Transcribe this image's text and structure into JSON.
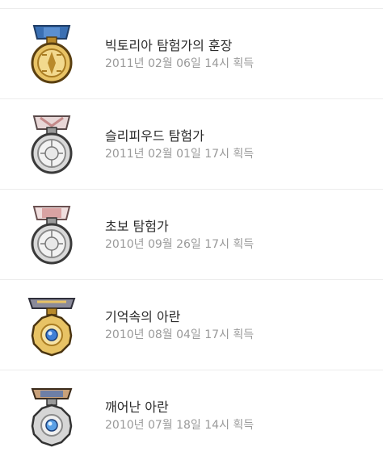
{
  "medals": [
    {
      "title": "빅토리아 탐험가의 훈장",
      "date": "2011년 02월 06일 14시 획득",
      "icon": "gold-medal-icon"
    },
    {
      "title": "슬리피우드 탐험가",
      "date": "2011년 02월 01일 17시 획득",
      "icon": "silver-medal-icon"
    },
    {
      "title": "초보 탐험가",
      "date": "2010년 09월 26일 17시 획득",
      "icon": "silver-medal-icon"
    },
    {
      "title": "기억속의 아란",
      "date": "2010년 08월 04일 17시 획득",
      "icon": "gold-gem-medal-icon"
    },
    {
      "title": "깨어난 아란",
      "date": "2010년 07월 18일 14시 획득",
      "icon": "silver-gem-medal-icon"
    }
  ]
}
